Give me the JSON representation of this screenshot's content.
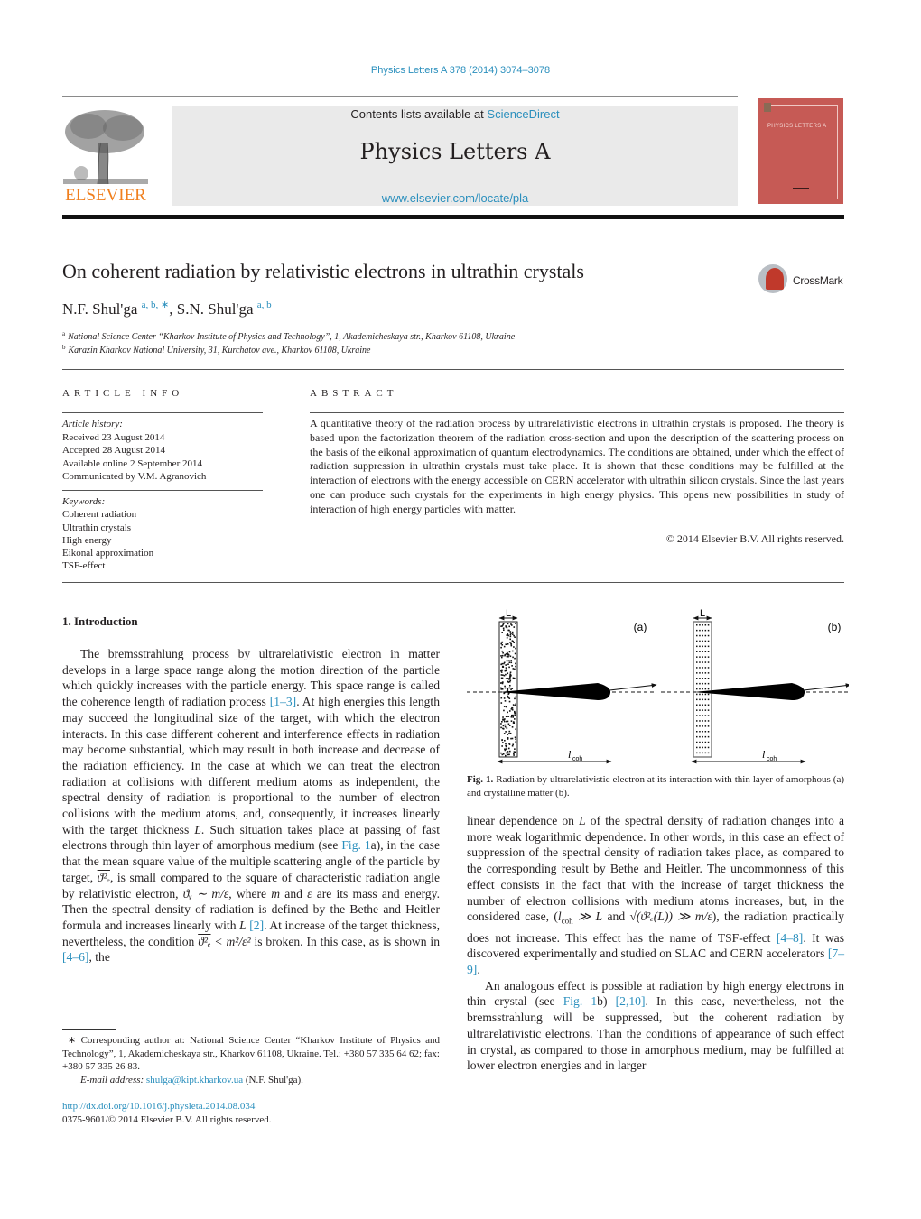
{
  "header": {
    "journal_ref": "Physics Letters A 378 (2014) 3074–3078",
    "contents_prefix": "Contents lists available at ",
    "contents_link": "ScienceDirect",
    "journal_name": "Physics Letters A",
    "journal_url": "www.elsevier.com/locate/pla",
    "publisher_logo_text": "ELSEVIER",
    "cover_title": "PHYSICS LETTERS A",
    "colors": {
      "link": "#2a8fbd",
      "elsevier_orange": "#f07f1e",
      "cover": "#c65a55",
      "masthead_bg": "#eaeaea"
    }
  },
  "article": {
    "title": "On coherent radiation by relativistic electrons in ultrathin crystals",
    "crossmark_label": "CrossMark",
    "authors": [
      {
        "name": "N.F. Shul'ga",
        "sup": "a, b, ∗"
      },
      {
        "name": "S.N. Shul'ga",
        "sup": "a, b"
      }
    ],
    "author_separator": ", ",
    "affiliations": [
      {
        "key": "a",
        "text": "National Science Center “Kharkov Institute of Physics and Technology”, 1, Akademicheskaya str., Kharkov 61108, Ukraine"
      },
      {
        "key": "b",
        "text": "Karazin Kharkov National University, 31, Kurchatov ave., Kharkov 61108, Ukraine"
      }
    ]
  },
  "article_info": {
    "heading": "ARTICLE INFO",
    "history_label": "Article history:",
    "history": [
      "Received 23 August 2014",
      "Accepted 28 August 2014",
      "Available online 2 September 2014",
      "Communicated by V.M. Agranovich"
    ],
    "keywords_label": "Keywords:",
    "keywords": [
      "Coherent radiation",
      "Ultrathin crystals",
      "High energy",
      "Eikonal approximation",
      "TSF-effect"
    ]
  },
  "abstract": {
    "heading": "ABSTRACT",
    "text": "A quantitative theory of the radiation process by ultrarelativistic electrons in ultrathin crystals is proposed. The theory is based upon the factorization theorem of the radiation cross-section and upon the description of the scattering process on the basis of the eikonal approximation of quantum electrodynamics. The conditions are obtained, under which the effect of radiation suppression in ultrathin crystals must take place. It is shown that these conditions may be fulfilled at the interaction of electrons with the energy accessible on CERN accelerator with ultrathin silicon crystals. Since the last years one can produce such crystals for the experiments in high energy physics. This opens new possibilities in study of interaction of high energy particles with matter.",
    "copyright": "© 2014 Elsevier B.V. All rights reserved."
  },
  "body": {
    "section_heading": "1. Introduction",
    "left": {
      "p1_a": "The bremsstrahlung process by ultrarelativistic electron in matter develops in a large space range along the motion direction of the particle which quickly increases with the particle energy. This space range is called the coherence length of radiation process ",
      "ref_1_3": "[1–3]",
      "p1_b": ". At high energies this length may succeed the longitudinal size of the target, with which the electron interacts. In this case different coherent and interference effects in radiation may become substantial, which may result in both increase and decrease of the radiation efficiency. In the case at which we can treat the electron radiation at collisions with different medium atoms as independent, the spectral density of radiation is proportional to the number of electron collisions with the medium atoms, and, consequently, it increases linearly with the target thickness ",
      "L1": "L",
      "p1_c": ". Such situation takes place at passing of fast electrons through thin layer of amorphous medium (see ",
      "fig_ref_a": "Fig. 1",
      "p1_d": "a), in the case that the mean square value of the multiple scattering angle of the particle by target, ",
      "theta_e2": "ϑ²ₑ",
      "p1_e": ", is small compared to the square of characteristic radiation angle by relativistic electron, ",
      "theta_gamma": "ϑᵧ ∼ m/ε",
      "p1_f": ", where ",
      "m": "m",
      "p1_g": " and ",
      "eps": "ε",
      "p1_h": " are its mass and energy. Then the spectral density of radiation is defined by the Bethe and Heitler formula and increases linearly with ",
      "L2": "L",
      "ref_2": "[2]",
      "p1_i": ". At increase of the target thickness, nevertheless, the condition ",
      "theta_e2_b": "ϑ²ₑ",
      "cond": " < m²/ε²",
      "p1_j": " is broken. In this case, as is shown in ",
      "ref_4_6": "[4–6]",
      "p1_k": ", the"
    },
    "right": {
      "p1_a": "linear dependence on ",
      "L": "L",
      "p1_b": " of the spectral density of radiation changes into a more weak logarithmic dependence. In other words, in this case an effect of suppression of the spectral density of radiation takes place, as compared to the corresponding result by Bethe and Heitler. The uncommonness of this effect consists in the fact that with the increase of target thickness the number of electron collisions with medium atoms increases, but, in the considered case, (",
      "lcoh_cond": "l",
      "lcoh_sub": "coh",
      "cond_a": " ≫ L",
      "and": " and ",
      "sqrt_expr": "√(ϑ²ₑ(L)) ≫ m/ε",
      "p1_c": "), the radiation practically does not increase. This effect has the name of TSF-effect ",
      "ref_4_8": "[4–8]",
      "p1_d": ". It was discovered experimentally and studied on SLAC and CERN accelerators ",
      "ref_7_9": "[7–9]",
      "p1_e": ".",
      "p2_a": "An analogous effect is possible at radiation by high energy electrons in thin crystal (see ",
      "fig_ref_b": "Fig. 1",
      "p2_b": "b) ",
      "ref_2_10": "[2,10]",
      "p2_c": ". In this case, nevertheless, not the bremsstrahlung will be suppressed, but the coherent radiation by ultrarelativistic electrons. Than the conditions of appearance of such effect in crystal, as compared to those in amorphous medium, may be fulfilled at lower electron energies and in larger"
    }
  },
  "figure": {
    "panels": [
      {
        "label": "(a)",
        "thickness_label": "L",
        "length_label": "l",
        "length_sub": "coh",
        "medium": "amorphous"
      },
      {
        "label": "(b)",
        "thickness_label": "L",
        "length_label": "l",
        "length_sub": "coh",
        "medium": "crystalline"
      }
    ],
    "caption_label": "Fig. 1.",
    "caption_text": " Radiation by ultrarelativistic electron at its interaction with thin layer of amorphous (a) and crystalline matter (b)."
  },
  "footnote": {
    "star": "∗",
    "text": " Corresponding author at: National Science Center “Kharkov Institute of Physics and Technology”, 1, Akademicheskaya str., Kharkov 61108, Ukraine. Tel.: +380 57 335 64 62; fax: +380 57 335 26 83.",
    "email_label": "E-mail address: ",
    "email": "shulga@kipt.kharkov.ua",
    "email_owner": " (N.F. Shul'ga)."
  },
  "doi": {
    "url": "http://dx.doi.org/10.1016/j.physleta.2014.08.034",
    "issn_line": "0375-9601/© 2014 Elsevier B.V. All rights reserved."
  }
}
